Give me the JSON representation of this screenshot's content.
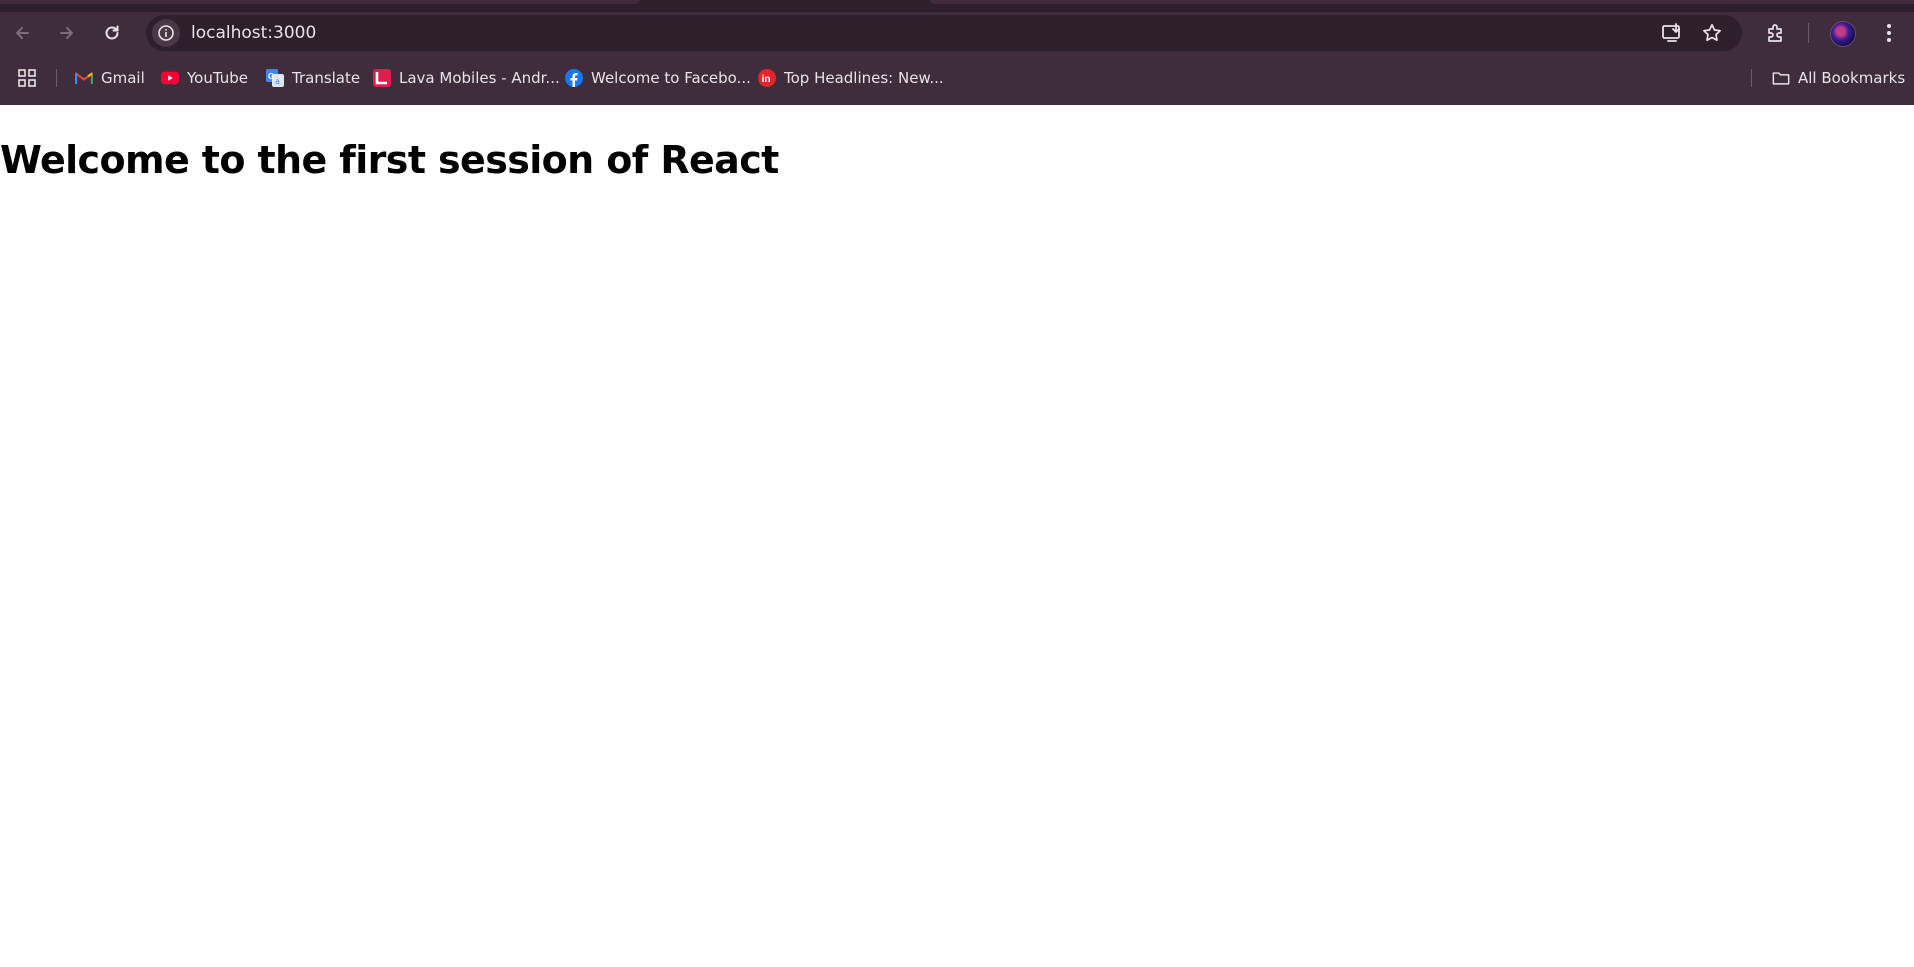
{
  "browser": {
    "url": "localhost:3000",
    "bookmarks": [
      {
        "label": "Gmail",
        "icon": "gmail-icon"
      },
      {
        "label": "YouTube",
        "icon": "youtube-icon"
      },
      {
        "label": "Translate",
        "icon": "translate-icon"
      },
      {
        "label": "Lava Mobiles - Andr...",
        "icon": "lava-icon"
      },
      {
        "label": "Welcome to Facebo...",
        "icon": "facebook-icon"
      },
      {
        "label": "Top Headlines: New...",
        "icon": "inshorts-icon"
      }
    ],
    "all_bookmarks_label": "All Bookmarks"
  },
  "page": {
    "heading": "Welcome to the first session of React"
  },
  "colors": {
    "chrome_bg": "#3f2d3d",
    "omnibox_bg": "#2e1f2c",
    "text_light": "#e8e3e7"
  }
}
